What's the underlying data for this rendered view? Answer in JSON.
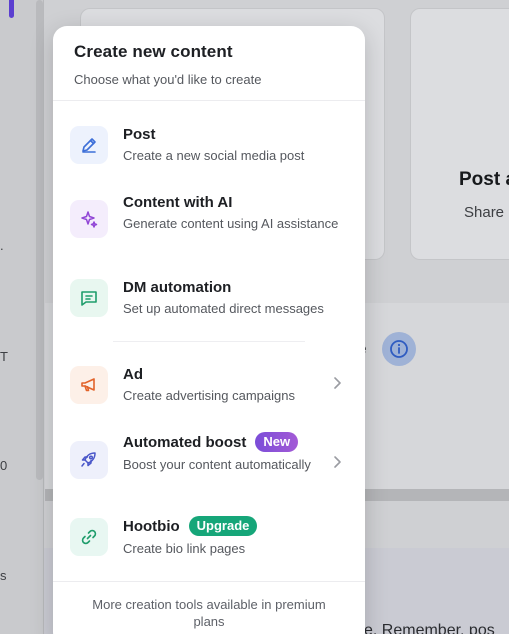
{
  "background": {
    "sidebar_fragments": [
      ".",
      "T",
      "0",
      "s"
    ],
    "card_title": "Post a",
    "card_subtitle": "Share",
    "panel_fragment": "e",
    "bottom_text": "e. Remember, pos"
  },
  "popup": {
    "title": "Create new content",
    "subtitle": "Choose what you'd like to create",
    "items": [
      {
        "label": "Post",
        "description": "Create a new social media post",
        "icon": "pencil-icon",
        "color": "#3d6fd8",
        "bg": "#edf2fd"
      },
      {
        "label": "Content with AI",
        "description": "Generate content using AI assistance",
        "icon": "sparkles-icon",
        "color": "#9146d6",
        "bg": "#f4edfc"
      },
      {
        "label": "DM automation",
        "description": "Set up automated direct messages",
        "icon": "message-icon",
        "color": "#1f9d6c",
        "bg": "#e8f7f0"
      },
      {
        "label": "Ad",
        "description": "Create advertising campaigns",
        "icon": "megaphone-icon",
        "color": "#e2632a",
        "bg": "#fdf0e8"
      },
      {
        "label": "Automated boost",
        "description": "Boost your content automatically",
        "badge": "New",
        "icon": "rocket-icon",
        "color": "#4a57c9",
        "bg": "#eef0fb"
      },
      {
        "label": "Hootbio",
        "description": "Create bio link pages",
        "badge": "Upgrade",
        "icon": "link-icon",
        "color": "#1f9d6c",
        "bg": "#e8f7f2"
      }
    ],
    "footer": "More creation tools available in premium plans"
  }
}
